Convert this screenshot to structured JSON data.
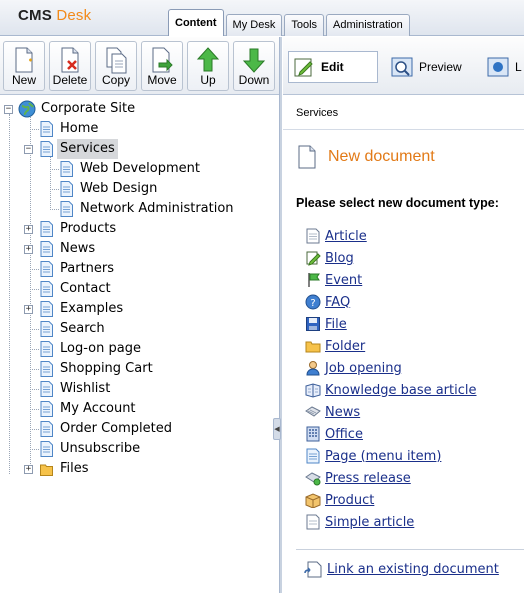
{
  "app": {
    "logo_cms": "CMS",
    "logo_desk": "Desk"
  },
  "tabs": [
    {
      "label": "Content",
      "active": true
    },
    {
      "label": "My Desk",
      "active": false
    },
    {
      "label": "Tools",
      "active": false
    },
    {
      "label": "Administration",
      "active": false
    }
  ],
  "toolbar": {
    "new": "New",
    "delete": "Delete",
    "copy": "Copy",
    "move": "Move",
    "up": "Up",
    "down": "Down"
  },
  "tree": {
    "root": "Corporate Site",
    "items": [
      "Home",
      "Services",
      "Web Development",
      "Web Design",
      "Network Administration",
      "Products",
      "News",
      "Partners",
      "Contact",
      "Examples",
      "Search",
      "Log-on page",
      "Shopping Cart",
      "Wishlist",
      "My Account",
      "Order Completed",
      "Unsubscribe",
      "Files"
    ],
    "selected": "Services"
  },
  "view": {
    "edit": "Edit",
    "preview": "Preview",
    "list_partial": "L"
  },
  "breadcrumb": "Services",
  "content": {
    "title": "New document",
    "prompt": "Please select new document type:",
    "doc_types": [
      "Article",
      "Blog",
      "Event",
      "FAQ",
      "File",
      "Folder",
      "Job opening",
      "Knowledge base article",
      "News",
      "Office",
      "Page (menu item)",
      "Press release",
      "Product",
      "Simple article"
    ],
    "link_existing": "Link an existing document"
  },
  "colors": {
    "accent": "#e27a17",
    "link": "#1a2f8a",
    "selection": "#d6d8db"
  }
}
